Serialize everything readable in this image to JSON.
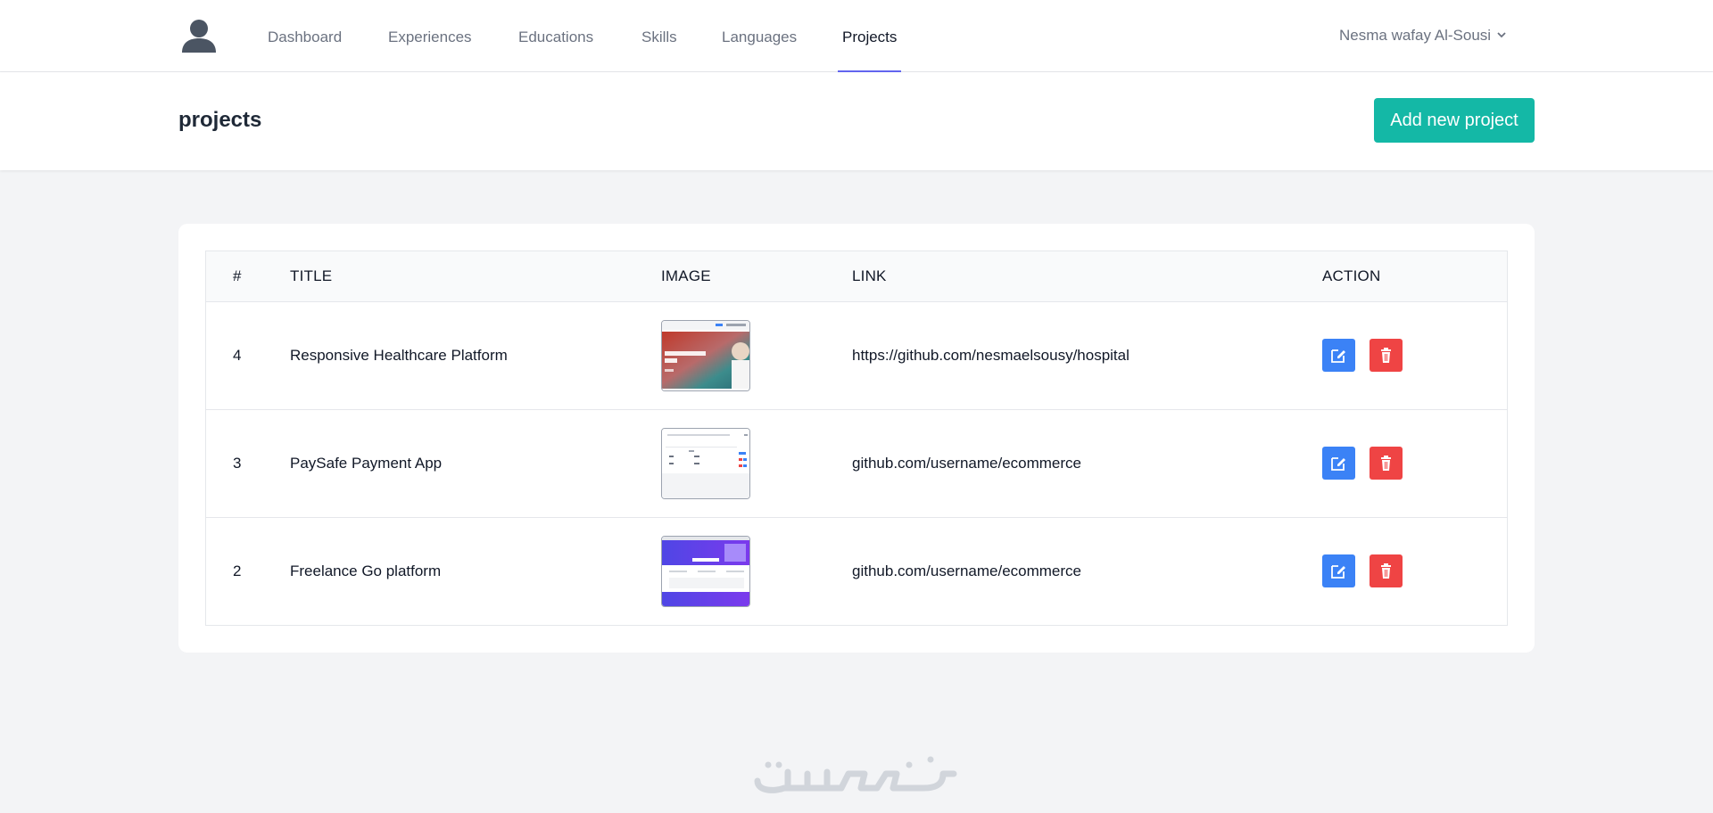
{
  "nav": {
    "links": [
      {
        "label": "Dashboard",
        "active": false
      },
      {
        "label": "Experiences",
        "active": false
      },
      {
        "label": "Educations",
        "active": false
      },
      {
        "label": "Skills",
        "active": false
      },
      {
        "label": "Languages",
        "active": false
      },
      {
        "label": "Projects",
        "active": true
      }
    ],
    "user_name": "Nesma wafay Al-Sousi",
    "user_icon": "chevron-down-icon",
    "avatar_icon": "user-avatar-icon"
  },
  "header": {
    "title": "projects",
    "add_button_label": "Add new project"
  },
  "table": {
    "columns": [
      "#",
      "TITLE",
      "IMAGE",
      "LINK",
      "ACTION"
    ],
    "rows": [
      {
        "id": "4",
        "title": "Responsive Healthcare Platform",
        "image": "healthcare-thumbnail",
        "link": "https://github.com/nesmaelsousy/hospital"
      },
      {
        "id": "3",
        "title": "PaySafe Payment App",
        "image": "paysafe-thumbnail",
        "link": "github.com/username/ecommerce"
      },
      {
        "id": "2",
        "title": "Freelance Go platform",
        "image": "freelance-thumbnail",
        "link": "github.com/username/ecommerce"
      }
    ],
    "thumb_text": "Healthcare Solution City"
  },
  "colors": {
    "accent": "#6366f1",
    "add_button": "#14b8a6",
    "edit_button": "#3b82f6",
    "delete_button": "#ef4444"
  },
  "watermark": {
    "text": "خمسات"
  }
}
